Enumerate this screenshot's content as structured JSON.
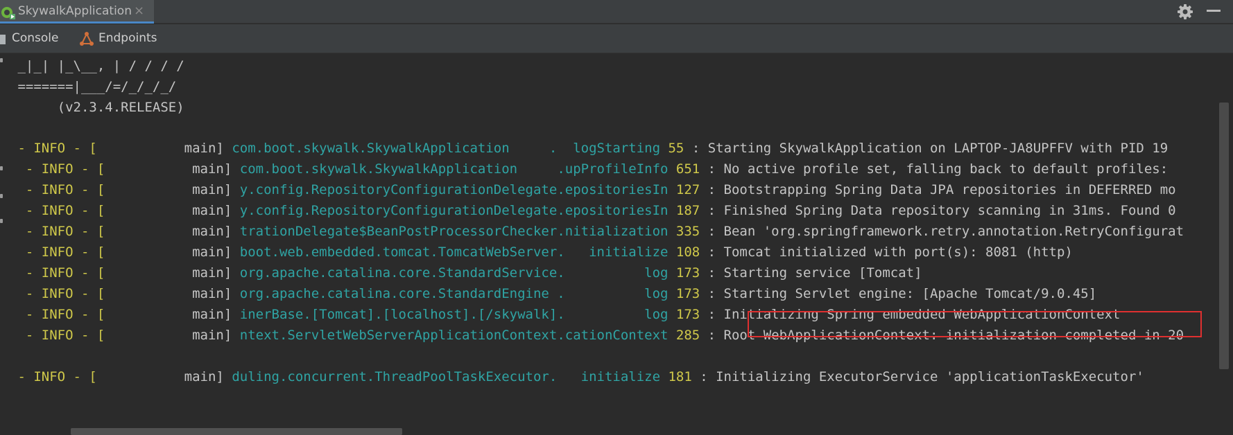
{
  "window": {
    "run_tab_title": "SkywalkApplication",
    "close_glyph": "×"
  },
  "tabs": [
    {
      "label": "Console",
      "icon": "console-icon"
    },
    {
      "label": "Endpoints",
      "icon": "endpoints-icon"
    }
  ],
  "banner": [
    " _|_| |_\\__, | / / / /",
    " =======|___/=/_/_/_/",
    "      (v2.3.4.RELEASE)"
  ],
  "log": [
    {
      "prefix": " - INFO - [",
      "thread": "           main] ",
      "logger": "com.boot.skywalk.SkywalkApplication     .  ",
      "method": "logStarting",
      "line": "55",
      "message": " : Starting SkywalkApplication on LAPTOP-JA8UPFFV with PID 19"
    },
    {
      "prefix": "  - INFO - [",
      "thread": "           main] ",
      "logger": "com.boot.skywalk.SkywalkApplication     ",
      "method": ".upProfileInfo",
      "line": "651",
      "message": " : No active profile set, falling back to default profiles:"
    },
    {
      "prefix": "  - INFO - [",
      "thread": "           main] ",
      "logger": "y.config.RepositoryConfigurationDelegate",
      "method": ".epositoriesIn",
      "line": "127",
      "message": " : Bootstrapping Spring Data JPA repositories in DEFERRED mo"
    },
    {
      "prefix": "  - INFO - [",
      "thread": "           main] ",
      "logger": "y.config.RepositoryConfigurationDelegate",
      "method": ".epositoriesIn",
      "line": "187",
      "message": " : Finished Spring Data repository scanning in 31ms. Found 0"
    },
    {
      "prefix": "  - INFO - [",
      "thread": "           main] ",
      "logger": "trationDelegate$BeanPostProcessorChecker",
      "method": ".nitialization",
      "line": "335",
      "message": " : Bean 'org.springframework.retry.annotation.RetryConfigurat"
    },
    {
      "prefix": "  - INFO - [",
      "thread": "           main] ",
      "logger": "boot.web.embedded.tomcat.TomcatWebServer.   ",
      "method": "initialize",
      "line": "108",
      "message": " : Tomcat initialized with port(s): 8081 (http)"
    },
    {
      "prefix": "  - INFO - [",
      "thread": "           main] ",
      "logger": "org.apache.catalina.core.StandardService.          ",
      "method": "log",
      "line": "173",
      "message": " : Starting service [Tomcat]"
    },
    {
      "prefix": "  - INFO - [",
      "thread": "           main] ",
      "logger": "org.apache.catalina.core.StandardEngine .          ",
      "method": "log",
      "line": "173",
      "message": " : Starting Servlet engine: [Apache Tomcat/9.0.45]"
    },
    {
      "prefix": "  - INFO - [",
      "thread": "           main] ",
      "logger": "inerBase.[Tomcat].[localhost].[/skywalk].          ",
      "method": "log",
      "line": "173",
      "message": " : Initializing Spring embedded WebApplicationContext"
    },
    {
      "prefix": "  - INFO - [",
      "thread": "           main] ",
      "logger": "ntext.ServletWebServerApplicationContext",
      "method": ".cationContext",
      "line": "285",
      "message": " : Root WebApplicationContext: initialization completed in 20"
    },
    {
      "prefix": " - INFO - [",
      "thread": "           main] ",
      "logger": "duling.concurrent.ThreadPoolTaskExecutor.   ",
      "method": "initialize",
      "line": "181",
      "message": " : Initializing ExecutorService 'applicationTaskExecutor'"
    }
  ],
  "colors": {
    "info": "#d0c94a",
    "logger": "#2fa4a4",
    "text": "#c5c5c5",
    "highlight_border": "#e03030"
  },
  "toolbar_icons": [
    "gear-icon",
    "minimize-icon"
  ]
}
